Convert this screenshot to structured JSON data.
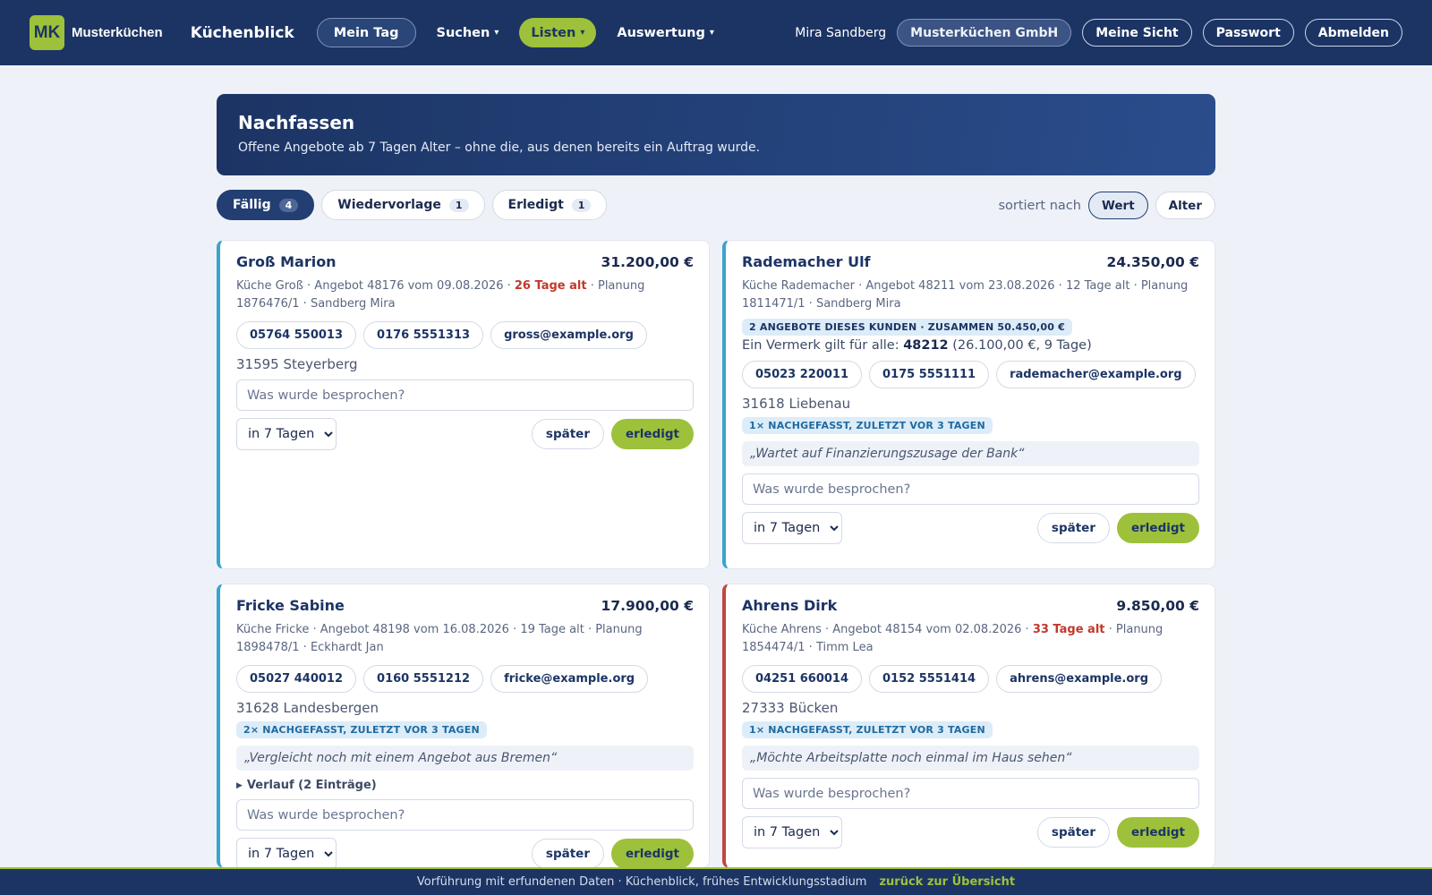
{
  "nav": {
    "logo_mark": "MK",
    "logo_text": "Musterküchen",
    "app_name": "Küchenblick",
    "items": [
      {
        "label": "Mein Tag"
      },
      {
        "label": "Suchen",
        "caret": "▾"
      },
      {
        "label": "Listen",
        "caret": "▾"
      },
      {
        "label": "Auswertung",
        "caret": "▾"
      }
    ],
    "user": "Mira Sandberg",
    "company": "Musterküchen GmbH",
    "my_view": "Meine Sicht",
    "password": "Passwort",
    "logout": "Abmelden"
  },
  "banner": {
    "title": "Nachfassen",
    "subtitle": "Offene Angebote ab 7 Tagen Alter – ohne die, aus denen bereits ein Auftrag wurde."
  },
  "filters": [
    {
      "label": "Fällig",
      "count": "4"
    },
    {
      "label": "Wiedervorlage",
      "count": "1"
    },
    {
      "label": "Erledigt",
      "count": "1"
    }
  ],
  "sort": {
    "label": "sortiert nach",
    "options": [
      "Wert",
      "Alter"
    ]
  },
  "common": {
    "note_placeholder": "Was wurde besprochen?",
    "followup_option": "in 7 Tagen",
    "later_label": "später",
    "done_label": "erledigt"
  },
  "cards": [
    {
      "customer": "Groß Marion",
      "amount": "31.200,00 €",
      "meta_a": "Küche Groß · Angebot 48176 vom 09.08.2026 · ",
      "age": "26 Tage alt",
      "meta_b": " · Planung 1876476/1 · Sandberg Mira",
      "phone": "05764 550013",
      "mobile": "0176 5551313",
      "email": "gross@example.org",
      "place": "31595 Steyerberg"
    },
    {
      "customer": "Rademacher Ulf",
      "amount": "24.350,00 €",
      "meta_a": "Küche Rademacher · Angebot 48211 vom 23.08.2026 · ",
      "age": "12 Tage alt",
      "meta_b": " · Planung 1811471/1 · Sandberg Mira",
      "group_badge": "2 ANGEBOTE DIESES KUNDEN · ZUSAMMEN 50.450,00 €",
      "group_note_a": "Ein Vermerk gilt für alle: ",
      "group_note_offer": "48212",
      "group_note_b": " (26.100,00 €, 9 Tage)",
      "phone": "05023 220011",
      "mobile": "0175 5551111",
      "email": "rademacher@example.org",
      "place": "31618 Liebenau",
      "followup_badge": "1× NACHGEFASST, ZULETZT VOR 3 TAGEN",
      "quote": "„Wartet auf Finanzierungszusage der Bank“"
    },
    {
      "customer": "Fricke Sabine",
      "amount": "17.900,00 €",
      "meta_a": "Küche Fricke · Angebot 48198 vom 16.08.2026 · ",
      "age": "19 Tage alt",
      "meta_b": " · Planung 1898478/1 · Eckhardt Jan",
      "phone": "05027 440012",
      "mobile": "0160 5551212",
      "email": "fricke@example.org",
      "place": "31628 Landesbergen",
      "followup_badge": "2× NACHGEFASST, ZULETZT VOR 3 TAGEN",
      "quote": "„Vergleicht noch mit einem Angebot aus Bremen“",
      "history": "Verlauf (2 Einträge)"
    },
    {
      "customer": "Ahrens Dirk",
      "amount": "9.850,00 €",
      "meta_a": "Küche Ahrens · Angebot 48154 vom 02.08.2026 · ",
      "age": "33 Tage alt",
      "meta_b": " · Planung 1854474/1 · Timm Lea",
      "phone": "04251 660014",
      "mobile": "0152 5551414",
      "email": "ahrens@example.org",
      "place": "27333 Bücken",
      "followup_badge": "1× NACHGEFASST, ZULETZT VOR 3 TAGEN",
      "quote": "„Möchte Arbeitsplatte noch einmal im Haus sehen“"
    }
  ],
  "footer": {
    "text": "Vorführung mit erfundenen Daten · Küchenblick, frühes Entwicklungsstadium",
    "link": "zurück zur Übersicht"
  },
  "colors": {
    "nav_bg": "#1c3464",
    "accent": "#9dc13a",
    "card_border_blue": "#3aa3cf",
    "card_border_red": "#c0463d",
    "overdue_text": "#c0392b"
  }
}
